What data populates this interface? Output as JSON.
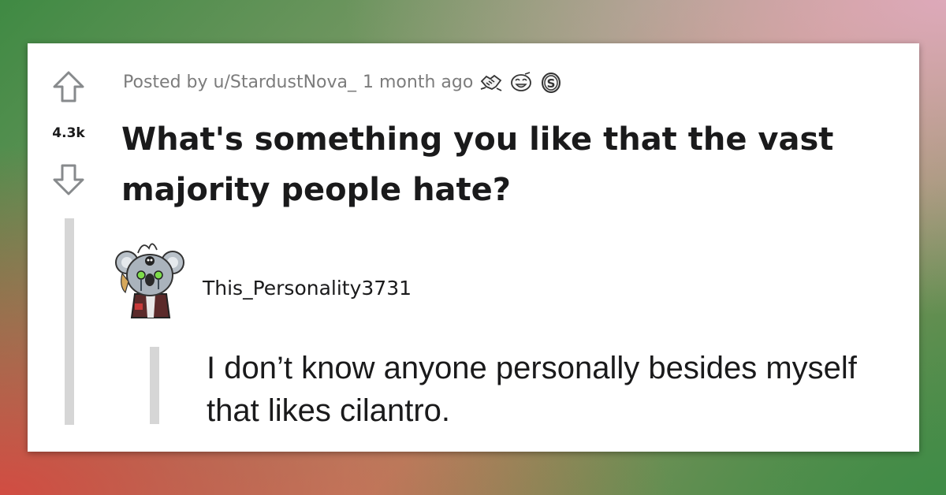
{
  "post": {
    "score": "4.3k",
    "posted_by": "Posted by u/StardustNova_",
    "time_ago": "1 month ago",
    "title": "What's something you like that the vast majority people hate?",
    "awards": [
      "handshake-award-icon",
      "laughing-face-award-icon",
      "silver-coin-award-icon"
    ]
  },
  "comment": {
    "author": "This_Personality3731",
    "text": "I don’t know anyone personally besides myself that likes cilantro."
  },
  "icons": {
    "upvote": "up-arrow-icon",
    "downvote": "down-arrow-icon",
    "avatar": "koala-avatar-icon"
  }
}
